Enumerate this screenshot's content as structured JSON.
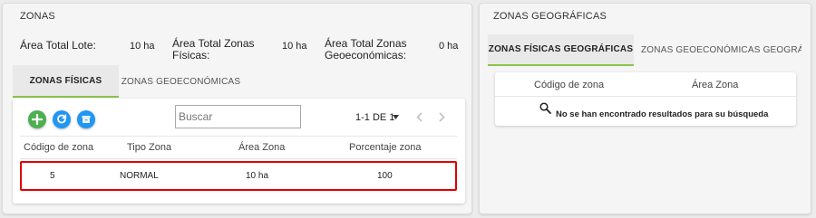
{
  "left_panel": {
    "title": "ZONAS",
    "summary": [
      {
        "label": "Área Total Lote:",
        "value": "10 ha"
      },
      {
        "label": "Área Total Zonas\nFísicas:",
        "value": "10 ha"
      },
      {
        "label": "Área Total Zonas\nGeoeconómicas:",
        "value": "0 ha"
      }
    ],
    "tabs": [
      {
        "label": "ZONAS FÍSICAS",
        "active": true
      },
      {
        "label": "ZONAS GEOECONÓMICAS",
        "active": false
      }
    ],
    "toolbar": {
      "add_icon": "plus-icon",
      "refresh_icon": "refresh-icon",
      "archive_icon": "archive-icon"
    },
    "search": {
      "placeholder": "Buscar",
      "value": ""
    },
    "pager": {
      "range": "1-1 DE 1",
      "dropdown_icon": "caret-down-icon",
      "prev_icon": "chevron-left-icon",
      "next_icon": "chevron-right-icon"
    },
    "table": {
      "columns": [
        "Código de zona",
        "Tipo Zona",
        "Área Zona",
        "Porcentaje zona"
      ],
      "rows": [
        [
          "5",
          "NORMAL",
          "10 ha",
          "100"
        ]
      ]
    }
  },
  "right_panel": {
    "title": "ZONAS GEOGRÁFICAS",
    "tabs": [
      {
        "label": "ZONAS FÍSICAS GEOGRÁFICAS",
        "active": true
      },
      {
        "label": "ZONAS GEOECONÓMICAS GEOGRÁF",
        "active": false
      }
    ],
    "table": {
      "columns": [
        "Código de zona",
        "Área Zona"
      ],
      "empty_message": "No se han encontrado resultados para su búsqueda",
      "empty_icon": "search-icon"
    }
  },
  "colors": {
    "accent_green": "#8bc34a",
    "add_button": "#4caf50",
    "action_buttons": "#2196f3",
    "row_highlight": "#e00000"
  }
}
